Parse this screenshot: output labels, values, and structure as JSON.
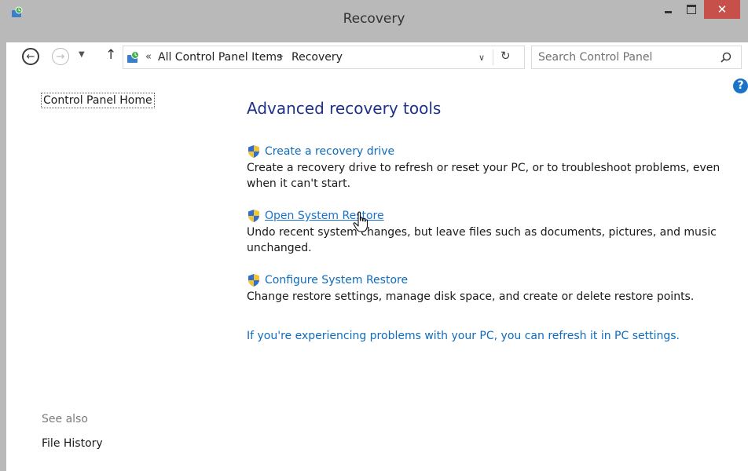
{
  "window": {
    "title": "Recovery"
  },
  "navigation": {
    "back_icon": "back-arrow-icon",
    "forward_icon": "forward-arrow-icon",
    "recent_icon": "chevron-down-icon",
    "up_icon": "up-arrow-icon"
  },
  "address": {
    "overflow": "«",
    "crumbs": [
      "All Control Panel Items",
      "Recovery"
    ],
    "separator": "▸"
  },
  "search": {
    "placeholder": "Search Control Panel"
  },
  "sidebar": {
    "home_link": "Control Panel Home",
    "see_also_label": "See also",
    "see_also_items": [
      "File History"
    ]
  },
  "main": {
    "title": "Advanced recovery tools",
    "tasks": [
      {
        "label": "Create a recovery drive",
        "description": "Create a recovery drive to refresh or reset your PC, or to troubleshoot problems, even when it can't start."
      },
      {
        "label": "Open System Restore",
        "description": "Undo recent system changes, but leave files such as documents, pictures, and music unchanged."
      },
      {
        "label": "Configure System Restore",
        "description": "Change restore settings, manage disk space, and create or delete restore points."
      }
    ],
    "refresh_link": "If you're experiencing problems with your PC, you can refresh it in PC settings."
  },
  "colors": {
    "chrome": "#b9b9b9",
    "close_button": "#c7504a",
    "title_blue": "#1e3287",
    "link_blue": "#0f6cbd"
  }
}
